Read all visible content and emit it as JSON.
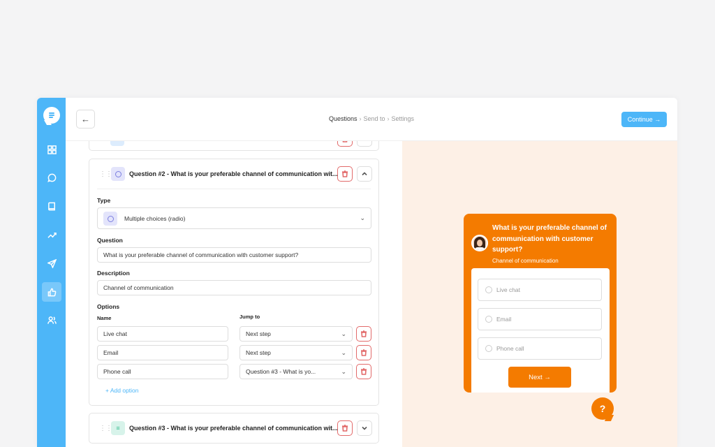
{
  "header": {
    "back_icon": "←",
    "breadcrumb": [
      "Questions",
      "Send to",
      "Settings"
    ],
    "breadcrumb_sep": "›",
    "continue_label": "Continue →"
  },
  "sidebar": {
    "items": [
      "dashboard-icon",
      "chat-icon",
      "book-icon",
      "analytics-icon",
      "send-icon",
      "thumbs-up-icon",
      "users-icon"
    ],
    "active": "thumbs-up-icon"
  },
  "editor": {
    "q2": {
      "title": "Question #2 - What is your preferable channel of communication wit...",
      "type_label": "Type",
      "type_value": "Multiple choices (radio)",
      "question_label": "Question",
      "question_value": "What is your preferable channel of communication with customer support?",
      "description_label": "Description",
      "description_value": "Channel of communication",
      "options_label": "Options",
      "name_col": "Name",
      "jump_col": "Jump to",
      "options": [
        {
          "name": "Live chat",
          "jump": "Next step"
        },
        {
          "name": "Email",
          "jump": "Next step"
        },
        {
          "name": "Phone call",
          "jump": "Question #3 - What is yo..."
        }
      ],
      "add_option": "+ Add option"
    },
    "q3": {
      "title": "Question #3 - What is your preferable channel of communication wit..."
    }
  },
  "preview": {
    "title": "What is your preferable channel of communication with customer support?",
    "subtitle": "Channel of communication",
    "options": [
      "Live chat",
      "Email",
      "Phone call"
    ],
    "next_label": "Next →",
    "help_label": "?"
  },
  "colors": {
    "accent": "#4db6f8",
    "widget": "#f47b00",
    "danger": "#e26a6a",
    "preview_bg": "#fdf0e6"
  }
}
